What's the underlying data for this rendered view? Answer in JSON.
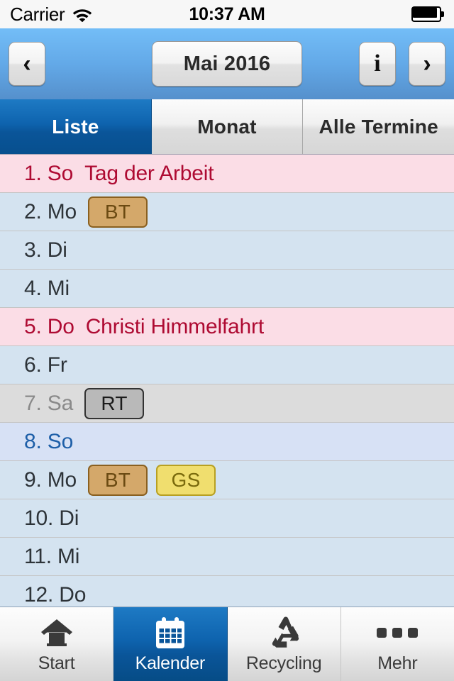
{
  "statusbar": {
    "carrier": "Carrier",
    "time": "10:37 AM",
    "wifi_icon": "wifi-icon",
    "battery_icon": "battery-full-icon"
  },
  "navbar": {
    "back_label": "‹",
    "back_icon": "chevron-left-icon",
    "title": "Mai 2016",
    "info_label": "i",
    "info_icon": "info-icon",
    "forward_label": "›",
    "forward_icon": "chevron-right-icon"
  },
  "segmented": {
    "selected_index": 0,
    "selected_color": "#0A5599",
    "items": [
      {
        "label": "Liste"
      },
      {
        "label": "Monat"
      },
      {
        "label": "Alle Termine"
      }
    ]
  },
  "list": {
    "rows": [
      {
        "day": "1. So",
        "kind": "holiday",
        "event": "Tag der Arbeit",
        "badges": []
      },
      {
        "day": "2. Mo",
        "kind": "weekday",
        "event": "",
        "badges": [
          {
            "label": "BT",
            "type": "bt",
            "color": "#D4A86A"
          }
        ]
      },
      {
        "day": "3. Di",
        "kind": "weekday",
        "event": "",
        "badges": []
      },
      {
        "day": "4. Mi",
        "kind": "weekday",
        "event": "",
        "badges": []
      },
      {
        "day": "5. Do",
        "kind": "holiday",
        "event": "Christi Himmelfahrt",
        "badges": []
      },
      {
        "day": "6. Fr",
        "kind": "weekday",
        "event": "",
        "badges": []
      },
      {
        "day": "7. Sa",
        "kind": "saturday",
        "event": "",
        "badges": [
          {
            "label": "RT",
            "type": "rt",
            "color": "#B9B9B9"
          }
        ]
      },
      {
        "day": "8. So",
        "kind": "sunday",
        "event": "",
        "badges": []
      },
      {
        "day": "9. Mo",
        "kind": "weekday",
        "event": "",
        "badges": [
          {
            "label": "BT",
            "type": "bt",
            "color": "#D4A86A"
          },
          {
            "label": "GS",
            "type": "gs",
            "color": "#F0DE6E"
          }
        ]
      },
      {
        "day": "10. Di",
        "kind": "weekday",
        "event": "",
        "badges": []
      },
      {
        "day": "11. Mi",
        "kind": "weekday",
        "event": "",
        "badges": []
      },
      {
        "day": "12. Do",
        "kind": "weekday",
        "event": "",
        "badges": []
      }
    ]
  },
  "tabbar": {
    "selected_index": 1,
    "items": [
      {
        "label": "Start",
        "icon": "home-icon"
      },
      {
        "label": "Kalender",
        "icon": "calendar-icon"
      },
      {
        "label": "Recycling",
        "icon": "recycle-icon"
      },
      {
        "label": "Mehr",
        "icon": "ellipsis-icon"
      }
    ]
  }
}
